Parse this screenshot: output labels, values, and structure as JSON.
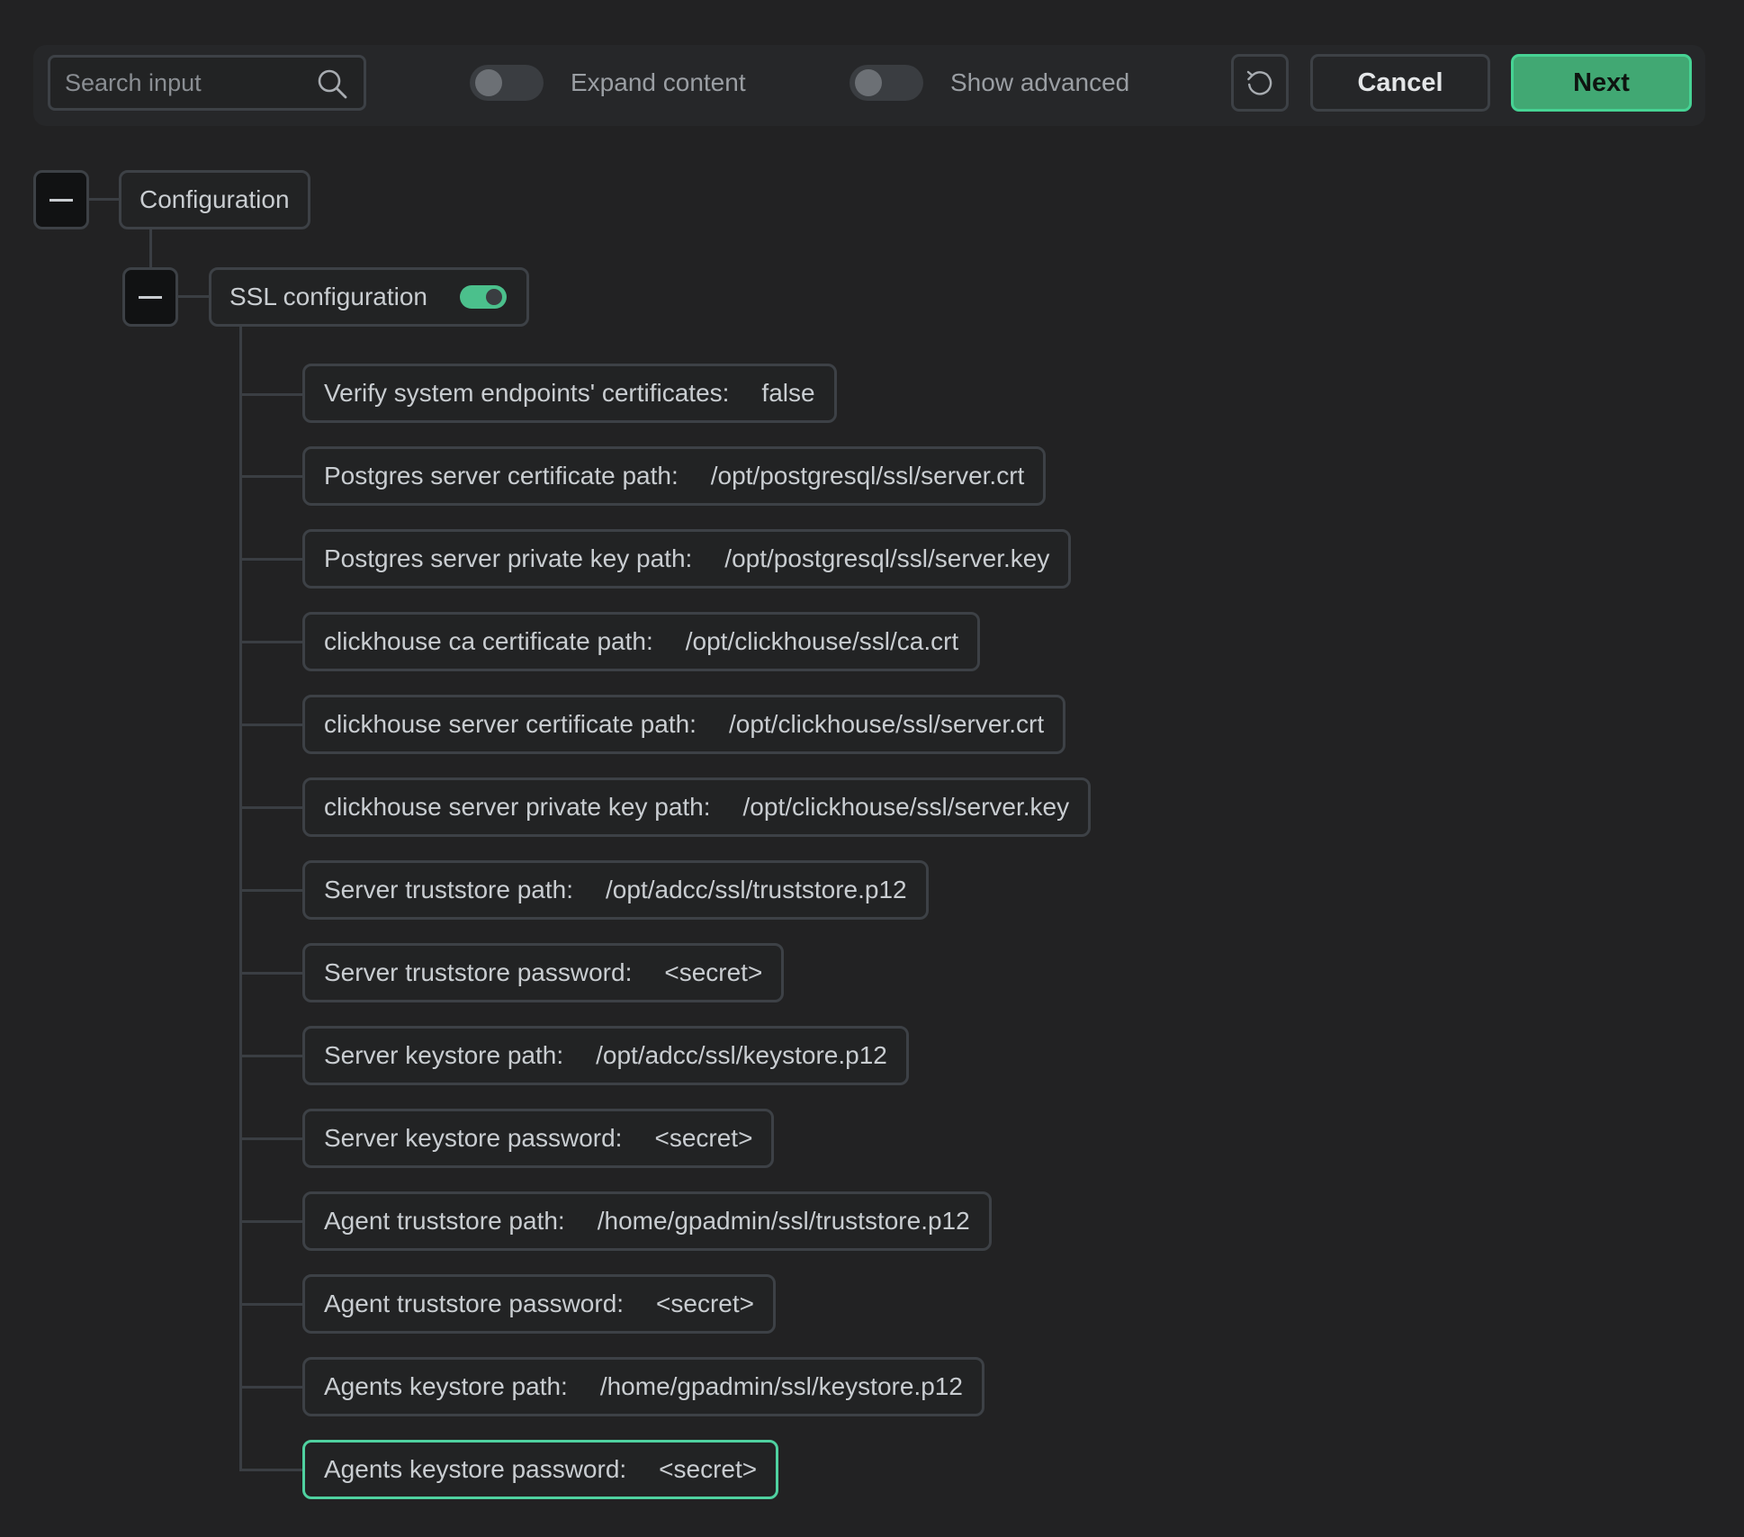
{
  "toolbar": {
    "search_placeholder": "Search input",
    "expand_label": "Expand content",
    "advanced_label": "Show advanced",
    "cancel_label": "Cancel",
    "next_label": "Next"
  },
  "tree": {
    "root_label": "Configuration",
    "group_label": "SSL configuration",
    "items": [
      {
        "label": "Verify system endpoints' certificates:",
        "value": "false"
      },
      {
        "label": "Postgres server certificate path:",
        "value": "/opt/postgresql/ssl/server.crt"
      },
      {
        "label": "Postgres server private key path:",
        "value": "/opt/postgresql/ssl/server.key"
      },
      {
        "label": "clickhouse ca certificate path:",
        "value": "/opt/clickhouse/ssl/ca.crt"
      },
      {
        "label": "clickhouse server certificate path:",
        "value": "/opt/clickhouse/ssl/server.crt"
      },
      {
        "label": "clickhouse server private key path:",
        "value": "/opt/clickhouse/ssl/server.key"
      },
      {
        "label": "Server truststore path:",
        "value": "/opt/adcc/ssl/truststore.p12"
      },
      {
        "label": "Server truststore password:",
        "value": "<secret>"
      },
      {
        "label": "Server keystore path:",
        "value": "/opt/adcc/ssl/keystore.p12"
      },
      {
        "label": "Server keystore password:",
        "value": "<secret>"
      },
      {
        "label": "Agent truststore path:",
        "value": "/home/gpadmin/ssl/truststore.p12"
      },
      {
        "label": "Agent truststore password:",
        "value": "<secret>"
      },
      {
        "label": "Agents keystore path:",
        "value": "/home/gpadmin/ssl/keystore.p12"
      },
      {
        "label": "Agents keystore password:",
        "value": "<secret>"
      }
    ]
  },
  "colors": {
    "background": "#222223",
    "accent": "#41a873",
    "accent_border": "#46d394",
    "selected_border": "#4fd1a0",
    "toggle_on": "#4bc08c"
  },
  "icons": {
    "search": "search-icon",
    "reset": "reset-icon",
    "collapse": "minus-icon"
  }
}
